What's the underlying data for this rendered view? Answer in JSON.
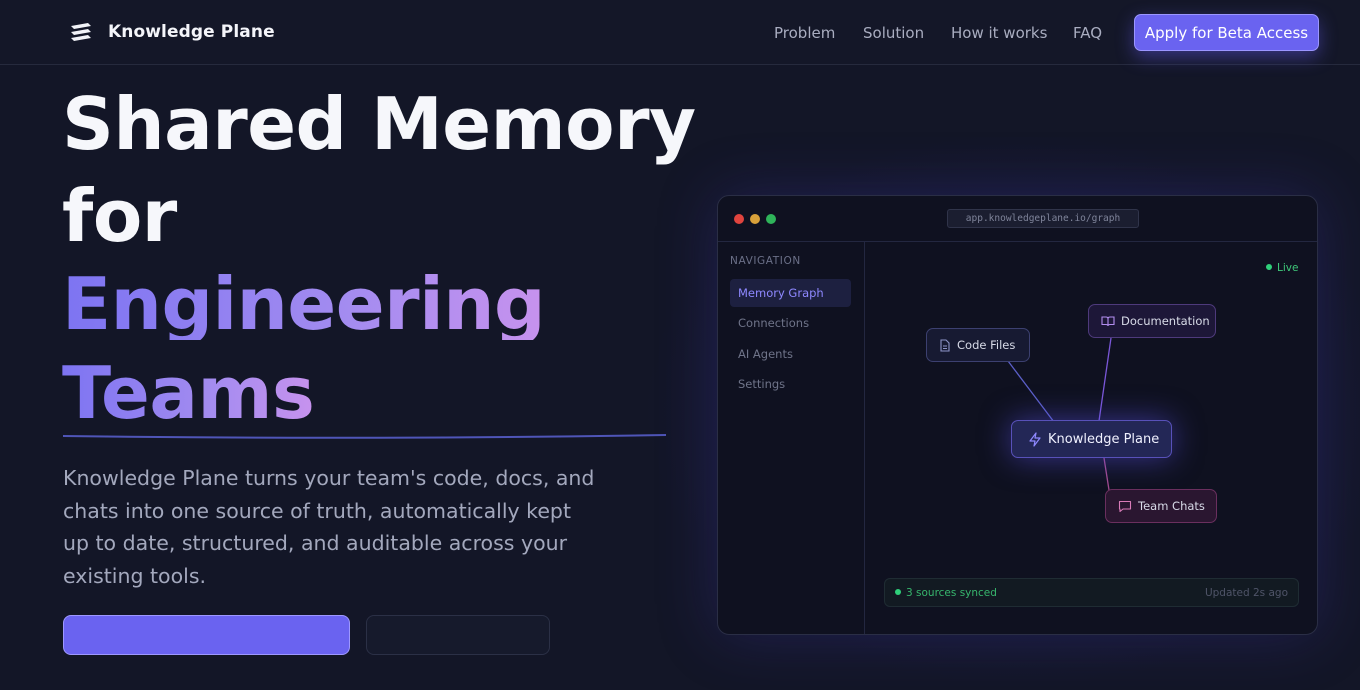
{
  "header": {
    "brand": "Knowledge Plane",
    "nav": [
      "Problem",
      "Solution",
      "How it works",
      "FAQ"
    ],
    "cta": "Apply for Beta Access"
  },
  "hero": {
    "line1": "Shared Memory",
    "line2": "for",
    "line3": "Engineering",
    "line4": "Teams",
    "description": "Knowledge Plane turns your team's code, docs, and chats into one source of truth, automatically kept up to date, structured, and auditable across your existing tools."
  },
  "preview": {
    "url": "app.knowledgeplane.io/graph",
    "nav_heading": "NAVIGATION",
    "nav_items": [
      "Memory Graph",
      "Connections",
      "AI Agents",
      "Settings"
    ],
    "live_label": "Live",
    "nodes": {
      "code": "Code Files",
      "docs": "Documentation",
      "core": "Knowledge Plane",
      "chats": "Team Chats"
    },
    "status_left": "3 sources synced",
    "status_right": "Updated 2s ago"
  },
  "colors": {
    "accent": "#6a63f0",
    "background": "#131627",
    "live": "#2fd07a"
  },
  "icons": [
    "stack-logo-icon",
    "file-icon",
    "book-icon",
    "zap-icon",
    "chat-icon"
  ]
}
